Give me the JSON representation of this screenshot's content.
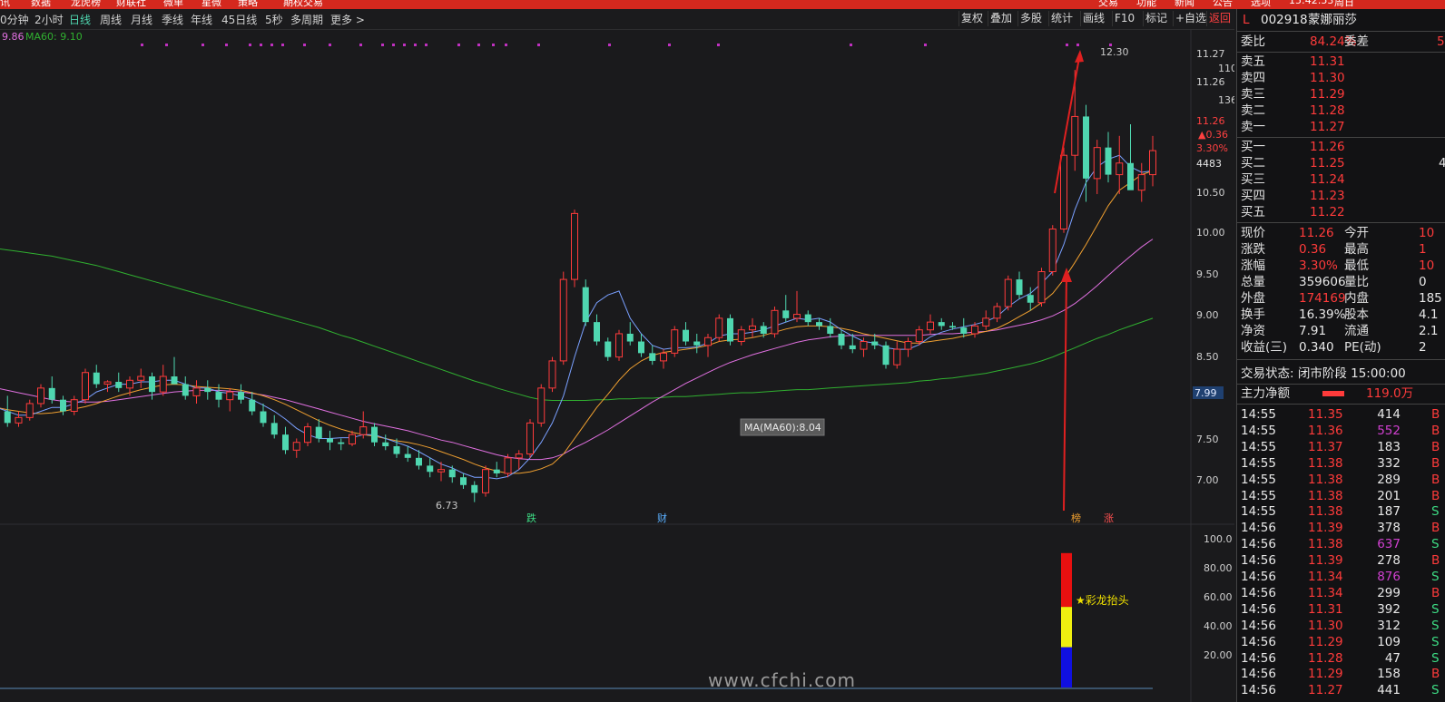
{
  "top_menu": [
    "讯",
    "数据",
    "龙虎榜",
    "财联社",
    "微单",
    "星微",
    "策略",
    "期权交易",
    "交易",
    "功能",
    "新闻",
    "公告",
    "选项",
    "15:42:53",
    "周日"
  ],
  "periods": [
    {
      "label": "0分钟"
    },
    {
      "label": "2小时"
    },
    {
      "label": "日线",
      "active": true
    },
    {
      "label": "周线"
    },
    {
      "label": "月线"
    },
    {
      "label": "季线"
    },
    {
      "label": "年线"
    },
    {
      "label": "45日线"
    },
    {
      "label": "5秒"
    },
    {
      "label": "多周期"
    },
    {
      "label": "更多 >"
    }
  ],
  "toolbar": [
    "复权",
    "叠加",
    "多股",
    "统计",
    "画线",
    "F10",
    "标记",
    "+自选",
    "返回"
  ],
  "ma_legend": {
    "ma_prev": "9.86",
    "ma60_label": "MA60:",
    "ma60_value": "9.10"
  },
  "price_axis": [
    "11.27",
    "11.26",
    "10.50",
    "10.00",
    "9.50",
    "9.00",
    "8.50",
    "7.99",
    "7.50",
    "7.00"
  ],
  "price_axis_aux": {
    "v110": "110",
    "v136": "136",
    "cur": "11.26",
    "chg": "▲0.36",
    "pct": "3.30%",
    "vol": "4483"
  },
  "ind_axis": [
    "100.0",
    "80.00",
    "60.00",
    "40.00",
    "20.00"
  ],
  "annotations": {
    "high": "12.30",
    "low": "6.73",
    "tooltip": "MA(MA60):8.04",
    "signal": "★彩龙抬头",
    "e1": "跌",
    "e2": "财",
    "e3": "榜",
    "e4": "涨"
  },
  "chart_colors": {
    "up": "#ff3b3b",
    "down": "#4fd7b0",
    "ma5": "#7aa0ff",
    "ma10": "#f0a030",
    "ma20": "#e070e0",
    "ma60": "#30b030",
    "bg": "#1a1a1c"
  },
  "chart_data": {
    "type": "candlestick",
    "ylim": [
      6.55,
      12.5
    ],
    "ohlc": [
      [
        8.05,
        8.15,
        7.85,
        7.9
      ],
      [
        7.9,
        8.1,
        7.7,
        7.75
      ],
      [
        7.75,
        7.9,
        7.7,
        7.82
      ],
      [
        7.82,
        8.05,
        7.78,
        8.0
      ],
      [
        8.0,
        8.25,
        7.95,
        8.2
      ],
      [
        8.2,
        8.35,
        8.0,
        8.05
      ],
      [
        8.05,
        8.1,
        7.85,
        7.9
      ],
      [
        7.9,
        8.1,
        7.85,
        8.05
      ],
      [
        8.05,
        8.45,
        8.0,
        8.4
      ],
      [
        8.4,
        8.5,
        8.2,
        8.25
      ],
      [
        8.25,
        8.3,
        8.15,
        8.28
      ],
      [
        8.28,
        8.4,
        8.15,
        8.2
      ],
      [
        8.2,
        8.35,
        8.1,
        8.3
      ],
      [
        8.3,
        8.45,
        8.2,
        8.35
      ],
      [
        8.35,
        8.4,
        8.05,
        8.15
      ],
      [
        8.15,
        8.5,
        8.1,
        8.35
      ],
      [
        8.35,
        8.6,
        8.25,
        8.25
      ],
      [
        8.25,
        8.35,
        8.05,
        8.1
      ],
      [
        8.1,
        8.3,
        8.0,
        8.2
      ],
      [
        8.2,
        8.3,
        8.05,
        8.15
      ],
      [
        8.15,
        8.25,
        7.95,
        8.05
      ],
      [
        8.05,
        8.2,
        7.9,
        8.15
      ],
      [
        8.15,
        8.25,
        8.0,
        8.05
      ],
      [
        8.05,
        8.15,
        7.85,
        7.9
      ],
      [
        7.9,
        8.0,
        7.7,
        7.75
      ],
      [
        7.75,
        7.85,
        7.55,
        7.6
      ],
      [
        7.6,
        7.7,
        7.35,
        7.4
      ],
      [
        7.4,
        7.55,
        7.3,
        7.5
      ],
      [
        7.5,
        7.75,
        7.45,
        7.7
      ],
      [
        7.7,
        7.8,
        7.5,
        7.55
      ],
      [
        7.55,
        7.65,
        7.4,
        7.5
      ],
      [
        7.5,
        7.55,
        7.4,
        7.48
      ],
      [
        7.48,
        7.65,
        7.45,
        7.6
      ],
      [
        7.6,
        7.9,
        7.55,
        7.7
      ],
      [
        7.7,
        7.75,
        7.45,
        7.5
      ],
      [
        7.5,
        7.6,
        7.4,
        7.45
      ],
      [
        7.45,
        7.55,
        7.3,
        7.35
      ],
      [
        7.35,
        7.45,
        7.25,
        7.3
      ],
      [
        7.3,
        7.4,
        7.15,
        7.2
      ],
      [
        7.2,
        7.3,
        7.05,
        7.12
      ],
      [
        7.12,
        7.25,
        7.0,
        7.15
      ],
      [
        7.15,
        7.2,
        6.98,
        7.05
      ],
      [
        7.05,
        7.1,
        6.9,
        6.95
      ],
      [
        6.95,
        7.0,
        6.73,
        6.85
      ],
      [
        6.85,
        7.2,
        6.8,
        7.15
      ],
      [
        7.15,
        7.25,
        7.05,
        7.1
      ],
      [
        7.1,
        7.35,
        7.05,
        7.3
      ],
      [
        7.3,
        7.4,
        7.15,
        7.35
      ],
      [
        7.35,
        7.8,
        7.3,
        7.75
      ],
      [
        7.75,
        8.25,
        7.7,
        8.2
      ],
      [
        8.2,
        8.6,
        8.15,
        8.55
      ],
      [
        8.55,
        9.7,
        8.5,
        9.6
      ],
      [
        9.6,
        10.5,
        9.5,
        10.45
      ],
      [
        9.5,
        9.6,
        9.0,
        9.05
      ],
      [
        9.05,
        9.15,
        8.75,
        8.8
      ],
      [
        8.8,
        8.85,
        8.55,
        8.6
      ],
      [
        8.6,
        8.95,
        8.55,
        8.9
      ],
      [
        8.9,
        9.05,
        8.75,
        8.8
      ],
      [
        8.8,
        8.9,
        8.6,
        8.65
      ],
      [
        8.65,
        8.75,
        8.5,
        8.55
      ],
      [
        8.55,
        8.7,
        8.45,
        8.65
      ],
      [
        8.65,
        9.0,
        8.6,
        8.95
      ],
      [
        8.95,
        9.05,
        8.75,
        8.8
      ],
      [
        8.8,
        8.9,
        8.65,
        8.75
      ],
      [
        8.75,
        8.9,
        8.6,
        8.85
      ],
      [
        8.85,
        9.15,
        8.8,
        9.1
      ],
      [
        9.1,
        9.15,
        8.75,
        8.8
      ],
      [
        8.8,
        9.0,
        8.75,
        8.95
      ],
      [
        8.95,
        9.1,
        8.85,
        9.0
      ],
      [
        9.0,
        9.05,
        8.85,
        8.9
      ],
      [
        8.9,
        9.25,
        8.85,
        9.2
      ],
      [
        9.2,
        9.4,
        9.05,
        9.1
      ],
      [
        9.1,
        9.45,
        9.05,
        9.15
      ],
      [
        9.15,
        9.2,
        9.0,
        9.05
      ],
      [
        9.05,
        9.1,
        8.95,
        9.0
      ],
      [
        9.0,
        9.1,
        8.85,
        8.9
      ],
      [
        8.9,
        8.95,
        8.7,
        8.75
      ],
      [
        8.75,
        8.9,
        8.65,
        8.7
      ],
      [
        8.7,
        8.85,
        8.6,
        8.8
      ],
      [
        8.8,
        8.9,
        8.7,
        8.75
      ],
      [
        8.75,
        8.8,
        8.45,
        8.5
      ],
      [
        8.5,
        8.8,
        8.45,
        8.7
      ],
      [
        8.7,
        8.85,
        8.6,
        8.8
      ],
      [
        8.8,
        9.0,
        8.75,
        8.95
      ],
      [
        8.95,
        9.15,
        8.9,
        9.05
      ],
      [
        9.05,
        9.1,
        8.95,
        9.0
      ],
      [
        9.0,
        9.05,
        8.95,
        8.98
      ],
      [
        8.98,
        9.1,
        8.85,
        8.9
      ],
      [
        8.9,
        9.05,
        8.85,
        9.0
      ],
      [
        9.0,
        9.2,
        8.95,
        9.1
      ],
      [
        9.1,
        9.3,
        9.05,
        9.25
      ],
      [
        9.25,
        9.65,
        9.2,
        9.6
      ],
      [
        9.6,
        9.7,
        9.35,
        9.4
      ],
      [
        9.4,
        9.5,
        9.2,
        9.3
      ],
      [
        9.3,
        9.75,
        9.25,
        9.7
      ],
      [
        9.7,
        10.3,
        9.65,
        10.25
      ],
      [
        10.25,
        11.3,
        10.2,
        11.2
      ],
      [
        11.2,
        12.3,
        11.0,
        11.7
      ],
      [
        11.7,
        11.85,
        10.6,
        10.9
      ],
      [
        10.9,
        11.4,
        10.7,
        11.3
      ],
      [
        11.3,
        11.5,
        10.85,
        10.95
      ],
      [
        10.95,
        11.45,
        10.7,
        11.1
      ],
      [
        11.1,
        11.6,
        10.85,
        10.75
      ],
      [
        10.75,
        11.1,
        10.6,
        10.95
      ],
      [
        10.95,
        11.45,
        10.8,
        11.26
      ]
    ],
    "ma5": [
      7.95,
      7.9,
      7.85,
      7.85,
      7.9,
      7.95,
      7.95,
      8.0,
      8.05,
      8.15,
      8.2,
      8.25,
      8.25,
      8.28,
      8.28,
      8.3,
      8.3,
      8.25,
      8.2,
      8.2,
      8.15,
      8.13,
      8.1,
      8.05,
      7.98,
      7.9,
      7.8,
      7.68,
      7.6,
      7.55,
      7.55,
      7.56,
      7.56,
      7.6,
      7.6,
      7.55,
      7.5,
      7.45,
      7.38,
      7.3,
      7.22,
      7.17,
      7.1,
      7.05,
      7.05,
      7.03,
      7.06,
      7.15,
      7.3,
      7.5,
      7.75,
      8.1,
      8.6,
      9.05,
      9.3,
      9.4,
      9.45,
      9.1,
      8.9,
      8.75,
      8.7,
      8.72,
      8.72,
      8.73,
      8.78,
      8.87,
      8.9,
      8.9,
      8.92,
      8.95,
      9.0,
      9.05,
      9.1,
      9.08,
      9.1,
      9.05,
      8.95,
      8.87,
      8.8,
      8.78,
      8.72,
      8.7,
      8.7,
      8.76,
      8.86,
      8.92,
      8.96,
      8.99,
      9.02,
      9.06,
      9.12,
      9.25,
      9.35,
      9.42,
      9.55,
      9.7,
      10.05,
      10.5,
      10.85,
      11.05,
      11.15,
      11.2,
      11.05,
      10.98,
      11.0
    ],
    "ma10": [
      7.95,
      7.92,
      7.9,
      7.88,
      7.87,
      7.88,
      7.9,
      7.93,
      7.96,
      8.0,
      8.05,
      8.1,
      8.14,
      8.18,
      8.21,
      8.24,
      8.25,
      8.24,
      8.22,
      8.21,
      8.2,
      8.19,
      8.17,
      8.14,
      8.1,
      8.05,
      7.99,
      7.92,
      7.85,
      7.78,
      7.72,
      7.67,
      7.63,
      7.6,
      7.58,
      7.55,
      7.52,
      7.5,
      7.47,
      7.43,
      7.38,
      7.33,
      7.28,
      7.22,
      7.17,
      7.13,
      7.1,
      7.1,
      7.12,
      7.16,
      7.22,
      7.35,
      7.55,
      7.75,
      7.95,
      8.12,
      8.3,
      8.45,
      8.55,
      8.62,
      8.66,
      8.68,
      8.7,
      8.72,
      8.75,
      8.8,
      8.82,
      8.83,
      8.85,
      8.88,
      8.92,
      8.96,
      8.99,
      9.0,
      9.0,
      8.99,
      8.97,
      8.94,
      8.9,
      8.87,
      8.84,
      8.81,
      8.78,
      8.78,
      8.8,
      8.82,
      8.84,
      8.87,
      8.9,
      8.93,
      8.97,
      9.04,
      9.12,
      9.2,
      9.3,
      9.42,
      9.6,
      9.82,
      10.05,
      10.3,
      10.55,
      10.75,
      10.85,
      10.95,
      11.0
    ],
    "ma20": [
      8.2,
      8.17,
      8.14,
      8.11,
      8.08,
      8.05,
      8.03,
      8.02,
      8.02,
      8.02,
      8.03,
      8.05,
      8.07,
      8.09,
      8.11,
      8.13,
      8.15,
      8.16,
      8.17,
      8.17,
      8.17,
      8.16,
      8.15,
      8.13,
      8.11,
      8.08,
      8.05,
      8.01,
      7.97,
      7.93,
      7.89,
      7.85,
      7.81,
      7.77,
      7.74,
      7.71,
      7.68,
      7.65,
      7.61,
      7.57,
      7.53,
      7.5,
      7.46,
      7.42,
      7.38,
      7.34,
      7.31,
      7.29,
      7.28,
      7.28,
      7.3,
      7.35,
      7.43,
      7.5,
      7.58,
      7.66,
      7.75,
      7.84,
      7.93,
      8.02,
      8.1,
      8.18,
      8.26,
      8.33,
      8.4,
      8.47,
      8.53,
      8.58,
      8.63,
      8.67,
      8.71,
      8.75,
      8.79,
      8.82,
      8.84,
      8.86,
      8.87,
      8.88,
      8.88,
      8.88,
      8.88,
      8.88,
      8.88,
      8.88,
      8.89,
      8.9,
      8.9,
      8.91,
      8.92,
      8.93,
      8.95,
      8.98,
      9.01,
      9.04,
      9.08,
      9.13,
      9.2,
      9.29,
      9.4,
      9.52,
      9.65,
      9.78,
      9.9,
      10.02,
      10.12
    ],
    "ma60": [
      10.0,
      9.98,
      9.96,
      9.94,
      9.92,
      9.9,
      9.87,
      9.84,
      9.81,
      9.78,
      9.74,
      9.7,
      9.66,
      9.62,
      9.58,
      9.54,
      9.5,
      9.46,
      9.42,
      9.38,
      9.34,
      9.3,
      9.26,
      9.22,
      9.18,
      9.14,
      9.1,
      9.06,
      9.02,
      8.98,
      8.93,
      8.88,
      8.84,
      8.79,
      8.74,
      8.69,
      8.64,
      8.59,
      8.54,
      8.49,
      8.44,
      8.39,
      8.34,
      8.29,
      8.25,
      8.2,
      8.16,
      8.12,
      8.08,
      8.05,
      8.04,
      8.04,
      8.04,
      8.04,
      8.05,
      8.05,
      8.06,
      8.06,
      8.07,
      8.07,
      8.08,
      8.09,
      8.09,
      8.1,
      8.11,
      8.12,
      8.13,
      8.14,
      8.14,
      8.15,
      8.16,
      8.17,
      8.18,
      8.18,
      8.19,
      8.2,
      8.21,
      8.22,
      8.23,
      8.24,
      8.25,
      8.26,
      8.27,
      8.29,
      8.3,
      8.32,
      8.33,
      8.35,
      8.37,
      8.39,
      8.42,
      8.45,
      8.48,
      8.51,
      8.55,
      8.6,
      8.66,
      8.72,
      8.78,
      8.84,
      8.89,
      8.95,
      9.0,
      9.05,
      9.1
    ],
    "indicator": {
      "red": [
        60,
        100
      ],
      "yellow": [
        30,
        60
      ],
      "blue": [
        0,
        30
      ],
      "ylim": [
        0,
        110
      ]
    }
  },
  "quote": {
    "market_tag": "L",
    "code": "002918",
    "name": "蒙娜丽莎",
    "wei_bi_label": "委比",
    "wei_bi": "84.24%",
    "wei_cha_label": "委差",
    "wei_cha": "5",
    "asks": [
      {
        "label": "卖五",
        "price": "11.31"
      },
      {
        "label": "卖四",
        "price": "11.30"
      },
      {
        "label": "卖三",
        "price": "11.29"
      },
      {
        "label": "卖二",
        "price": "11.28"
      },
      {
        "label": "卖一",
        "price": "11.27"
      }
    ],
    "bids": [
      {
        "label": "买一",
        "price": "11.26"
      },
      {
        "label": "买二",
        "price": "11.25",
        "vol": "4"
      },
      {
        "label": "买三",
        "price": "11.24"
      },
      {
        "label": "买四",
        "price": "11.23"
      },
      {
        "label": "买五",
        "price": "11.22"
      }
    ],
    "stats": [
      {
        "l1": "现价",
        "v1": "11.26",
        "l2": "今开",
        "v2": "10"
      },
      {
        "l1": "涨跌",
        "v1": "0.36",
        "l2": "最高",
        "v2": "1"
      },
      {
        "l1": "涨幅",
        "v1": "3.30%",
        "l2": "最低",
        "v2": "10"
      },
      {
        "l1": "总量",
        "v1": "359606",
        "l2": "量比",
        "v2": "0"
      },
      {
        "l1": "外盘",
        "v1": "174169",
        "l2": "内盘",
        "v2": "185"
      },
      {
        "l1": "换手",
        "v1": "16.39%",
        "l2": "股本",
        "v2": "4.1"
      },
      {
        "l1": "净资",
        "v1": "7.91",
        "l2": "流通",
        "v2": "2.1"
      },
      {
        "l1": "收益(三)",
        "v1": "0.340",
        "l2": "PE(动)",
        "v2": "2"
      }
    ],
    "status_line": "交易状态: 闭市阶段 15:00:00",
    "main_net_label": "主力净额",
    "main_net": "119.0万",
    "ticks": [
      {
        "t": "14:55",
        "p": "11.35",
        "v": "414",
        "s": "B"
      },
      {
        "t": "14:55",
        "p": "11.36",
        "v": "552",
        "s": "B"
      },
      {
        "t": "14:55",
        "p": "11.37",
        "v": "183",
        "s": "B"
      },
      {
        "t": "14:55",
        "p": "11.38",
        "v": "332",
        "s": "B"
      },
      {
        "t": "14:55",
        "p": "11.38",
        "v": "289",
        "s": "B"
      },
      {
        "t": "14:55",
        "p": "11.38",
        "v": "201",
        "s": "B"
      },
      {
        "t": "14:55",
        "p": "11.38",
        "v": "187",
        "s": "S"
      },
      {
        "t": "14:56",
        "p": "11.39",
        "v": "378",
        "s": "B"
      },
      {
        "t": "14:56",
        "p": "11.38",
        "v": "637",
        "s": "S"
      },
      {
        "t": "14:56",
        "p": "11.39",
        "v": "278",
        "s": "B"
      },
      {
        "t": "14:56",
        "p": "11.34",
        "v": "876",
        "s": "S"
      },
      {
        "t": "14:56",
        "p": "11.34",
        "v": "299",
        "s": "B"
      },
      {
        "t": "14:56",
        "p": "11.31",
        "v": "392",
        "s": "S"
      },
      {
        "t": "14:56",
        "p": "11.30",
        "v": "312",
        "s": "S"
      },
      {
        "t": "14:56",
        "p": "11.29",
        "v": "109",
        "s": "S"
      },
      {
        "t": "14:56",
        "p": "11.28",
        "v": "47",
        "s": "S"
      },
      {
        "t": "14:56",
        "p": "11.29",
        "v": "158",
        "s": "B"
      },
      {
        "t": "14:56",
        "p": "11.27",
        "v": "441",
        "s": "S"
      }
    ]
  },
  "watermark": "www.cfchi.com"
}
